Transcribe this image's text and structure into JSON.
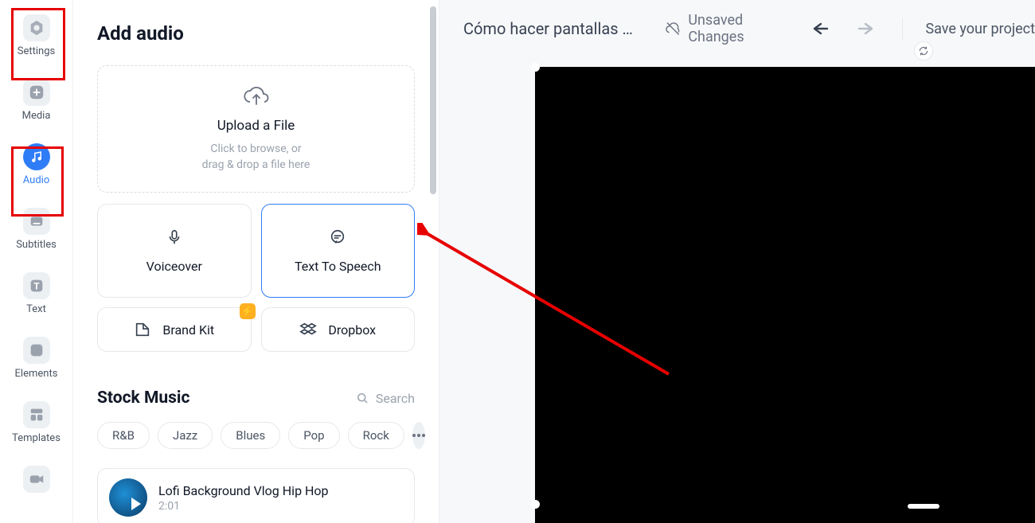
{
  "rail": {
    "items": [
      {
        "id": "settings",
        "label": "Settings"
      },
      {
        "id": "media",
        "label": "Media"
      },
      {
        "id": "audio",
        "label": "Audio"
      },
      {
        "id": "subtitles",
        "label": "Subtitles"
      },
      {
        "id": "text",
        "label": "Text"
      },
      {
        "id": "elements",
        "label": "Elements"
      },
      {
        "id": "templates",
        "label": "Templates"
      }
    ]
  },
  "panel": {
    "title": "Add audio",
    "upload": {
      "title": "Upload a File",
      "subtitle_l1": "Click to browse, or",
      "subtitle_l2": "drag & drop a file here"
    },
    "options": {
      "voiceover": "Voiceover",
      "tts": "Text To Speech",
      "brandkit": "Brand Kit",
      "dropbox": "Dropbox"
    },
    "stock": {
      "heading": "Stock Music",
      "search": "Search",
      "genres": [
        "R&B",
        "Jazz",
        "Blues",
        "Pop",
        "Rock"
      ],
      "track": {
        "title": "Lofi Background Vlog Hip Hop",
        "duration": "2:01"
      }
    }
  },
  "topbar": {
    "project_title": "Cómo hacer pantallas final...",
    "unsaved": "Unsaved Changes",
    "save": "Save your project"
  }
}
